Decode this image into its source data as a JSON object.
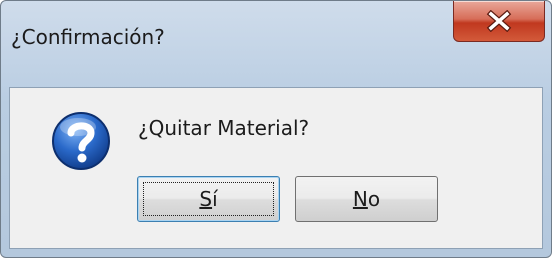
{
  "dialog": {
    "title": "¿Confirmación?",
    "message": "¿Quitar Material?",
    "icon": "question-icon",
    "close_icon": "close-icon"
  },
  "buttons": {
    "yes": {
      "mnemonic": "S",
      "rest": "í",
      "default": true
    },
    "no": {
      "mnemonic": "N",
      "rest": "o",
      "default": false
    }
  },
  "colors": {
    "title_bar": "#b9cde2",
    "close_button": "#c0381f",
    "client_background": "#f0f0f0",
    "question_icon": "#1f5fbf",
    "default_button_border": "#3c7fb1"
  }
}
